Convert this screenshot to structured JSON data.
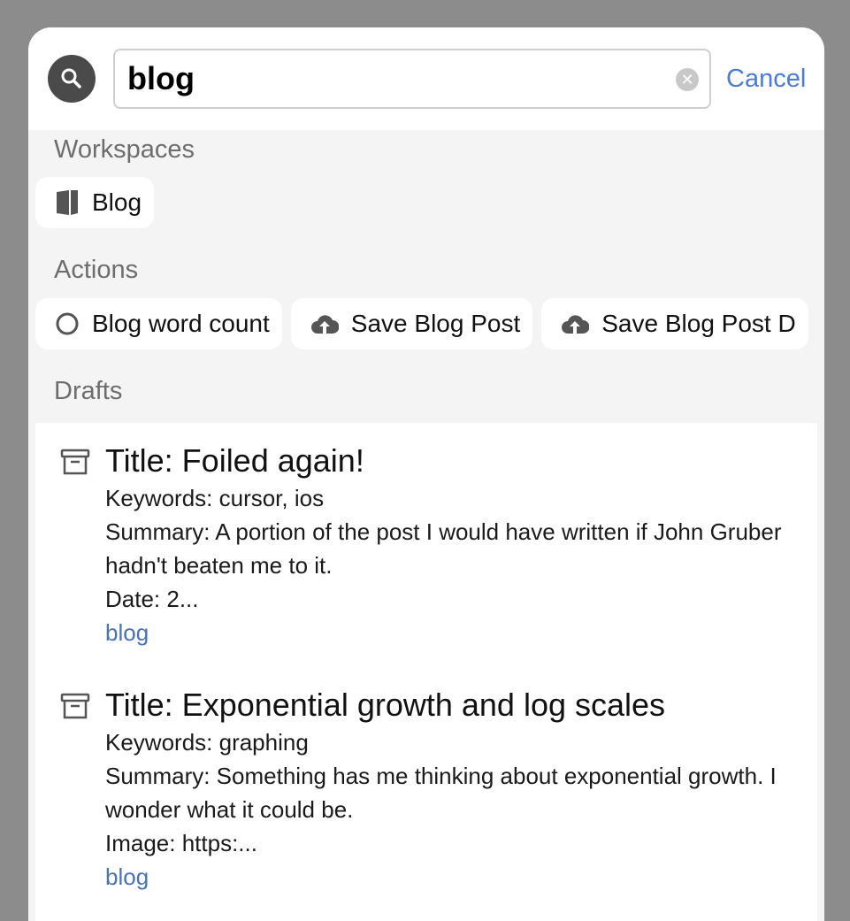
{
  "search": {
    "query": "blog",
    "cancel_label": "Cancel"
  },
  "workspaces": {
    "heading": "Workspaces",
    "items": [
      {
        "label": "Blog",
        "icon": "book-icon"
      }
    ]
  },
  "actions": {
    "heading": "Actions",
    "items": [
      {
        "label": "Blog word count",
        "icon": "circle-icon"
      },
      {
        "label": "Save Blog Post",
        "icon": "cloud-upload-icon"
      },
      {
        "label": "Save Blog Post D",
        "icon": "cloud-upload-icon"
      }
    ]
  },
  "drafts": {
    "heading": "Drafts",
    "items": [
      {
        "title": "Title: Foiled again!",
        "lines": [
          "Keywords: cursor, ios",
          "Summary: A portion of the post I would have written if John Gruber hadn't beaten me to it.",
          "Date: 2..."
        ],
        "tag": "blog"
      },
      {
        "title": "Title: Exponential growth and log scales",
        "lines": [
          "Keywords: graphing",
          "Summary: Something has me thinking about exponential growth. I wonder what it could be.",
          "Image: https:..."
        ],
        "tag": "blog"
      }
    ]
  },
  "colors": {
    "accent": "#4a7bdc",
    "tag": "#4a72b8",
    "overlay": "#8c8c8c"
  }
}
